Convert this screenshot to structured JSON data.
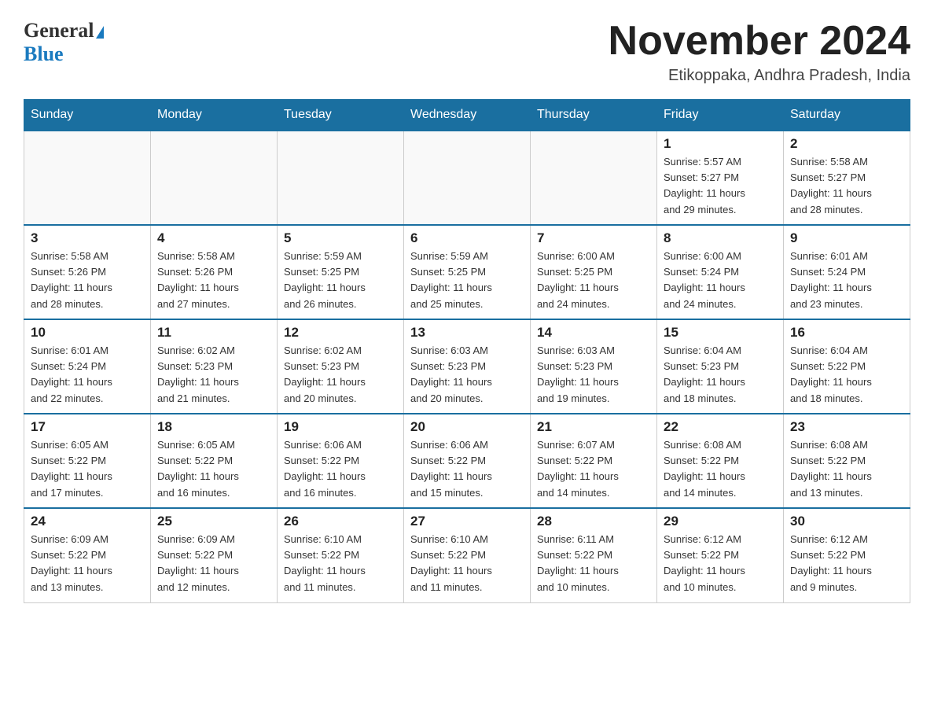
{
  "header": {
    "logo_general": "General",
    "logo_blue": "Blue",
    "month_title": "November 2024",
    "location": "Etikoppaka, Andhra Pradesh, India"
  },
  "weekdays": [
    "Sunday",
    "Monday",
    "Tuesday",
    "Wednesday",
    "Thursday",
    "Friday",
    "Saturday"
  ],
  "weeks": [
    [
      {
        "day": "",
        "info": ""
      },
      {
        "day": "",
        "info": ""
      },
      {
        "day": "",
        "info": ""
      },
      {
        "day": "",
        "info": ""
      },
      {
        "day": "",
        "info": ""
      },
      {
        "day": "1",
        "info": "Sunrise: 5:57 AM\nSunset: 5:27 PM\nDaylight: 11 hours\nand 29 minutes."
      },
      {
        "day": "2",
        "info": "Sunrise: 5:58 AM\nSunset: 5:27 PM\nDaylight: 11 hours\nand 28 minutes."
      }
    ],
    [
      {
        "day": "3",
        "info": "Sunrise: 5:58 AM\nSunset: 5:26 PM\nDaylight: 11 hours\nand 28 minutes."
      },
      {
        "day": "4",
        "info": "Sunrise: 5:58 AM\nSunset: 5:26 PM\nDaylight: 11 hours\nand 27 minutes."
      },
      {
        "day": "5",
        "info": "Sunrise: 5:59 AM\nSunset: 5:25 PM\nDaylight: 11 hours\nand 26 minutes."
      },
      {
        "day": "6",
        "info": "Sunrise: 5:59 AM\nSunset: 5:25 PM\nDaylight: 11 hours\nand 25 minutes."
      },
      {
        "day": "7",
        "info": "Sunrise: 6:00 AM\nSunset: 5:25 PM\nDaylight: 11 hours\nand 24 minutes."
      },
      {
        "day": "8",
        "info": "Sunrise: 6:00 AM\nSunset: 5:24 PM\nDaylight: 11 hours\nand 24 minutes."
      },
      {
        "day": "9",
        "info": "Sunrise: 6:01 AM\nSunset: 5:24 PM\nDaylight: 11 hours\nand 23 minutes."
      }
    ],
    [
      {
        "day": "10",
        "info": "Sunrise: 6:01 AM\nSunset: 5:24 PM\nDaylight: 11 hours\nand 22 minutes."
      },
      {
        "day": "11",
        "info": "Sunrise: 6:02 AM\nSunset: 5:23 PM\nDaylight: 11 hours\nand 21 minutes."
      },
      {
        "day": "12",
        "info": "Sunrise: 6:02 AM\nSunset: 5:23 PM\nDaylight: 11 hours\nand 20 minutes."
      },
      {
        "day": "13",
        "info": "Sunrise: 6:03 AM\nSunset: 5:23 PM\nDaylight: 11 hours\nand 20 minutes."
      },
      {
        "day": "14",
        "info": "Sunrise: 6:03 AM\nSunset: 5:23 PM\nDaylight: 11 hours\nand 19 minutes."
      },
      {
        "day": "15",
        "info": "Sunrise: 6:04 AM\nSunset: 5:23 PM\nDaylight: 11 hours\nand 18 minutes."
      },
      {
        "day": "16",
        "info": "Sunrise: 6:04 AM\nSunset: 5:22 PM\nDaylight: 11 hours\nand 18 minutes."
      }
    ],
    [
      {
        "day": "17",
        "info": "Sunrise: 6:05 AM\nSunset: 5:22 PM\nDaylight: 11 hours\nand 17 minutes."
      },
      {
        "day": "18",
        "info": "Sunrise: 6:05 AM\nSunset: 5:22 PM\nDaylight: 11 hours\nand 16 minutes."
      },
      {
        "day": "19",
        "info": "Sunrise: 6:06 AM\nSunset: 5:22 PM\nDaylight: 11 hours\nand 16 minutes."
      },
      {
        "day": "20",
        "info": "Sunrise: 6:06 AM\nSunset: 5:22 PM\nDaylight: 11 hours\nand 15 minutes."
      },
      {
        "day": "21",
        "info": "Sunrise: 6:07 AM\nSunset: 5:22 PM\nDaylight: 11 hours\nand 14 minutes."
      },
      {
        "day": "22",
        "info": "Sunrise: 6:08 AM\nSunset: 5:22 PM\nDaylight: 11 hours\nand 14 minutes."
      },
      {
        "day": "23",
        "info": "Sunrise: 6:08 AM\nSunset: 5:22 PM\nDaylight: 11 hours\nand 13 minutes."
      }
    ],
    [
      {
        "day": "24",
        "info": "Sunrise: 6:09 AM\nSunset: 5:22 PM\nDaylight: 11 hours\nand 13 minutes."
      },
      {
        "day": "25",
        "info": "Sunrise: 6:09 AM\nSunset: 5:22 PM\nDaylight: 11 hours\nand 12 minutes."
      },
      {
        "day": "26",
        "info": "Sunrise: 6:10 AM\nSunset: 5:22 PM\nDaylight: 11 hours\nand 11 minutes."
      },
      {
        "day": "27",
        "info": "Sunrise: 6:10 AM\nSunset: 5:22 PM\nDaylight: 11 hours\nand 11 minutes."
      },
      {
        "day": "28",
        "info": "Sunrise: 6:11 AM\nSunset: 5:22 PM\nDaylight: 11 hours\nand 10 minutes."
      },
      {
        "day": "29",
        "info": "Sunrise: 6:12 AM\nSunset: 5:22 PM\nDaylight: 11 hours\nand 10 minutes."
      },
      {
        "day": "30",
        "info": "Sunrise: 6:12 AM\nSunset: 5:22 PM\nDaylight: 11 hours\nand 9 minutes."
      }
    ]
  ]
}
